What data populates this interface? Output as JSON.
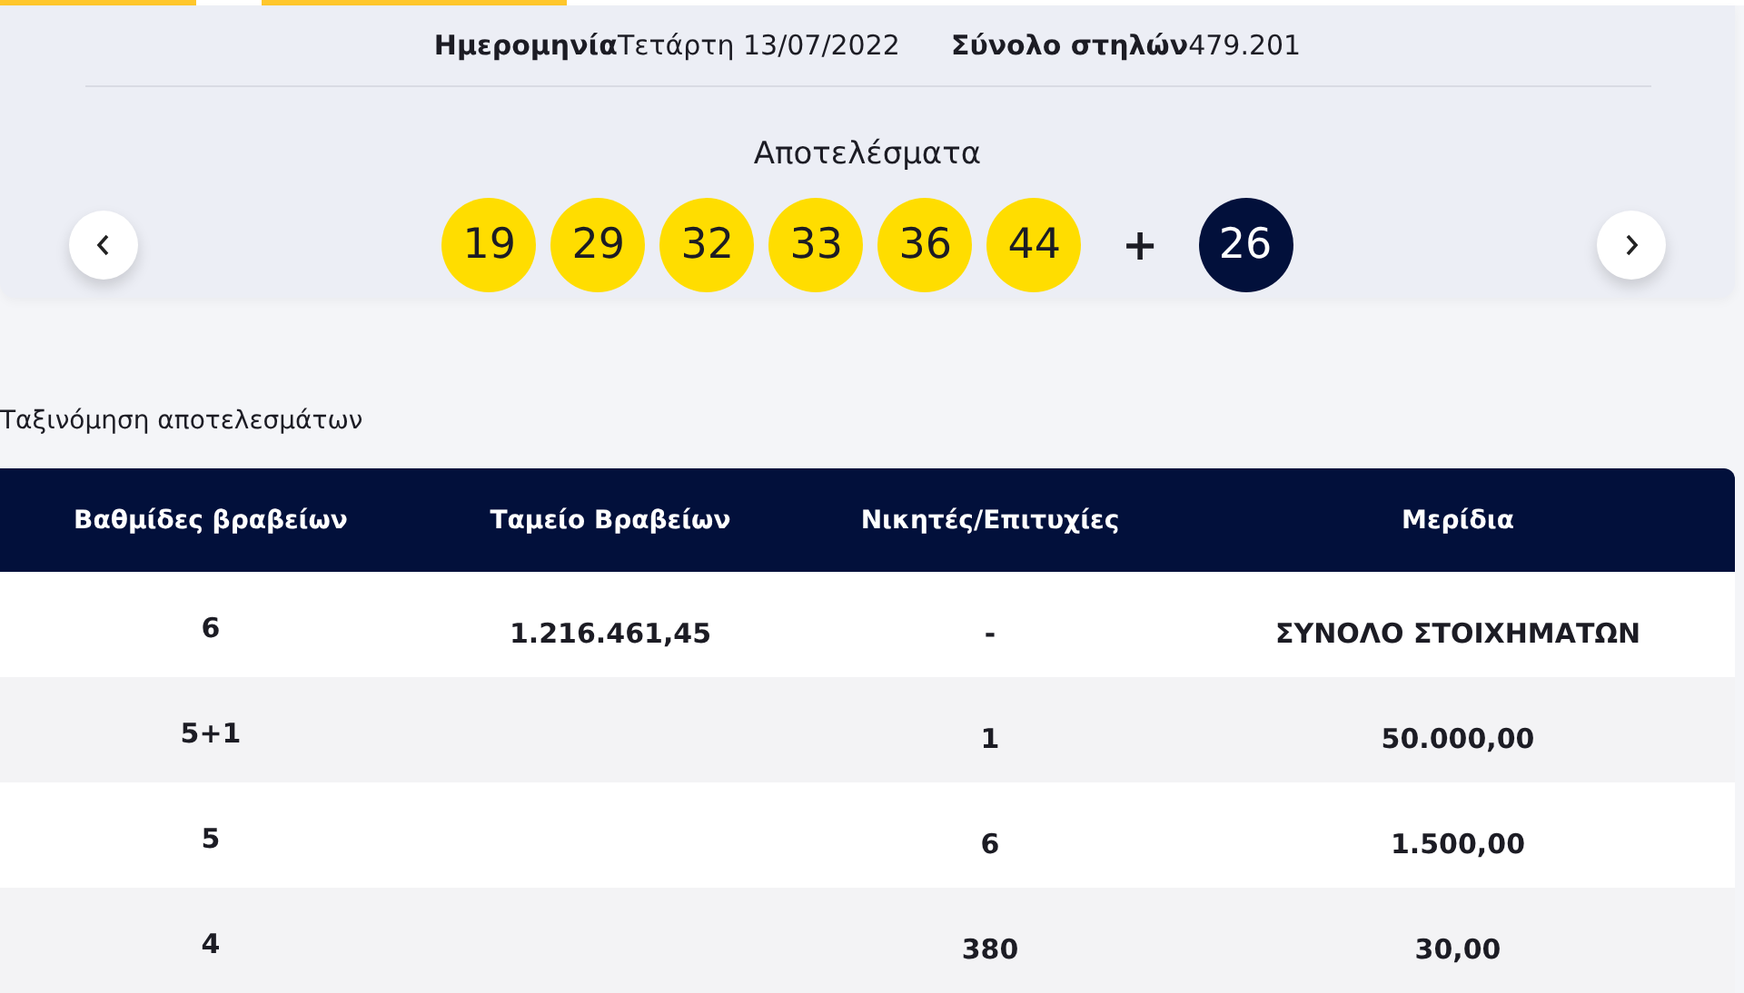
{
  "draw_info": {
    "date_label": "Ημερομηνία",
    "date_value": "Τετάρτη 13/07/2022",
    "columns_label": "Σύνολο στηλών",
    "columns_value": "479.201"
  },
  "results": {
    "title": "Αποτελέσματα",
    "numbers": [
      "19",
      "29",
      "32",
      "33",
      "36",
      "44"
    ],
    "plus": "+",
    "bonus": "26"
  },
  "sort_label": "Ταξινόμηση αποτελεσμάτων",
  "table": {
    "columns": [
      "Βαθμίδες βραβείων",
      "Ταμείο Βραβείων",
      "Νικητές/Επιτυχίες",
      "Μερίδια"
    ],
    "rows": [
      [
        "6",
        "1.216.461,45",
        "-",
        "ΣΥΝΟΛΟ ΣΤΟΙΧΗΜΑΤΩΝ"
      ],
      [
        "5+1",
        "",
        "1",
        "50.000,00"
      ],
      [
        "5",
        "",
        "6",
        "1.500,00"
      ],
      [
        "4",
        "",
        "380",
        "30,00"
      ]
    ]
  }
}
